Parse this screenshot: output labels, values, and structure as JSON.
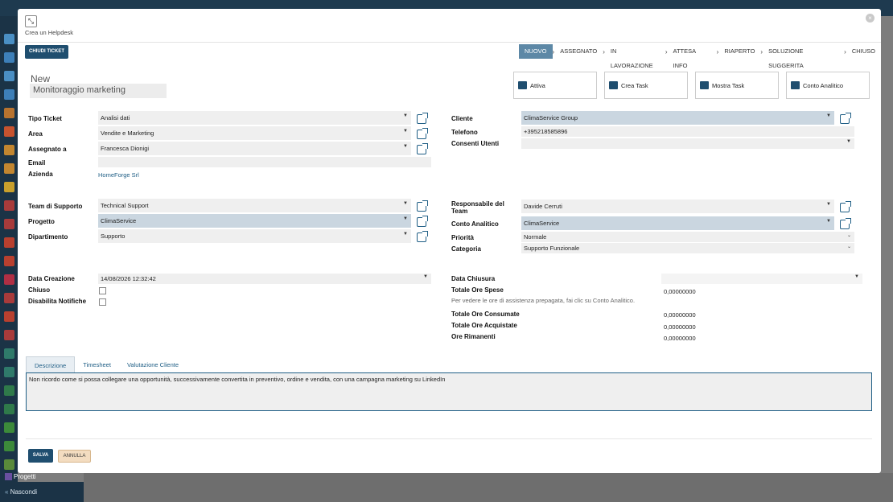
{
  "window": {
    "title": "Crea un Helpdesk",
    "close_label": "×",
    "restore_label": "⤡"
  },
  "background": {
    "bottom_items": [
      "Progetti",
      "Nascondi"
    ]
  },
  "toolbar": {
    "close_ticket_label": "CHIUDI TICKET"
  },
  "stages": [
    "NUOVO",
    "ASSEGNATO",
    "IN LAVORAZIONE",
    "ATTESA INFO",
    "RIAPERTO",
    "SOLUZIONE SUGGERITA",
    "CHIUSO"
  ],
  "stage_active": "NUOVO",
  "ticket": {
    "state": "New",
    "name": "Monitoraggio marketing"
  },
  "smart_buttons": [
    {
      "label": "Attiva",
      "icon": "archive-icon"
    },
    {
      "label": "Crea Task",
      "icon": "tasks-icon"
    },
    {
      "label": "Mostra Task",
      "icon": "edit-icon"
    },
    {
      "label": "Conto Analitico",
      "icon": "book-icon"
    }
  ],
  "left_group1": {
    "tipo_ticket": {
      "label": "Tipo Ticket",
      "value": "Analisi dati"
    },
    "area": {
      "label": "Area",
      "value": "Vendite e Marketing"
    },
    "assegnato": {
      "label": "Assegnato a",
      "value": "Francesca Dionigi"
    },
    "email": {
      "label": "Email",
      "value": ""
    },
    "azienda": {
      "label": "Azienda",
      "value": "HomeForge Srl"
    }
  },
  "right_group1": {
    "cliente": {
      "label": "Cliente",
      "value": "ClimaService Group"
    },
    "telefono": {
      "label": "Telefono",
      "value": "+395218585896"
    },
    "consensi": {
      "label": "Consenti Utenti",
      "value": ""
    }
  },
  "left_group2": {
    "team": {
      "label": "Team di Supporto",
      "value": "Technical Support"
    },
    "progetto": {
      "label": "Progetto",
      "value": "ClimaService"
    },
    "dipartimento": {
      "label": "Dipartimento",
      "value": "Supporto"
    }
  },
  "right_group2": {
    "responsabile": {
      "label": "Responsabile del Team",
      "value": "Davide Cerruti"
    },
    "conto": {
      "label": "Conto Analitico",
      "value": "ClimaService"
    },
    "priorita": {
      "label": "Priorità",
      "value": "Normale"
    },
    "categoria": {
      "label": "Categoria",
      "value": "Supporto Funzionale"
    }
  },
  "left_group3": {
    "data_creazione": {
      "label": "Data Creazione",
      "value": "14/08/2026 12:32:42"
    },
    "chiuso": {
      "label": "Chiuso"
    },
    "disabilita": {
      "label": "Disabilita Notifiche"
    }
  },
  "right_group3": {
    "data_chiusura": {
      "label": "Data Chiusura",
      "value": ""
    },
    "ore_spese": {
      "label": "Totale Ore Spese",
      "value": "0,00000000"
    },
    "hint": "Per vedere le ore di assistenza prepagata, fai clic su Conto Analitico.",
    "ore_consumate": {
      "label": "Totale Ore Consumate",
      "value": "0,00000000"
    },
    "ore_acquistate": {
      "label": "Totale Ore Acquistate",
      "value": "0,00000000"
    },
    "ore_rimanenti": {
      "label": "Ore Rimanenti",
      "value": "0,00000000"
    }
  },
  "tabs": [
    "Descrizione",
    "Timesheet",
    "Valutazione Cliente"
  ],
  "description": "Non ricordo come si possa collegare una opportunità, successivamente convertita in preventivo, ordine e vendita, con una campagna marketing su LinkedIn",
  "footer": {
    "save_label": "SALVA",
    "cancel_label": "ANNULLA"
  },
  "colors": {
    "accent": "#1f4e6f",
    "stage_active": "#5d88a6",
    "highlight_field": "#cad6e0",
    "cancel_button": "#f3dcc0"
  }
}
